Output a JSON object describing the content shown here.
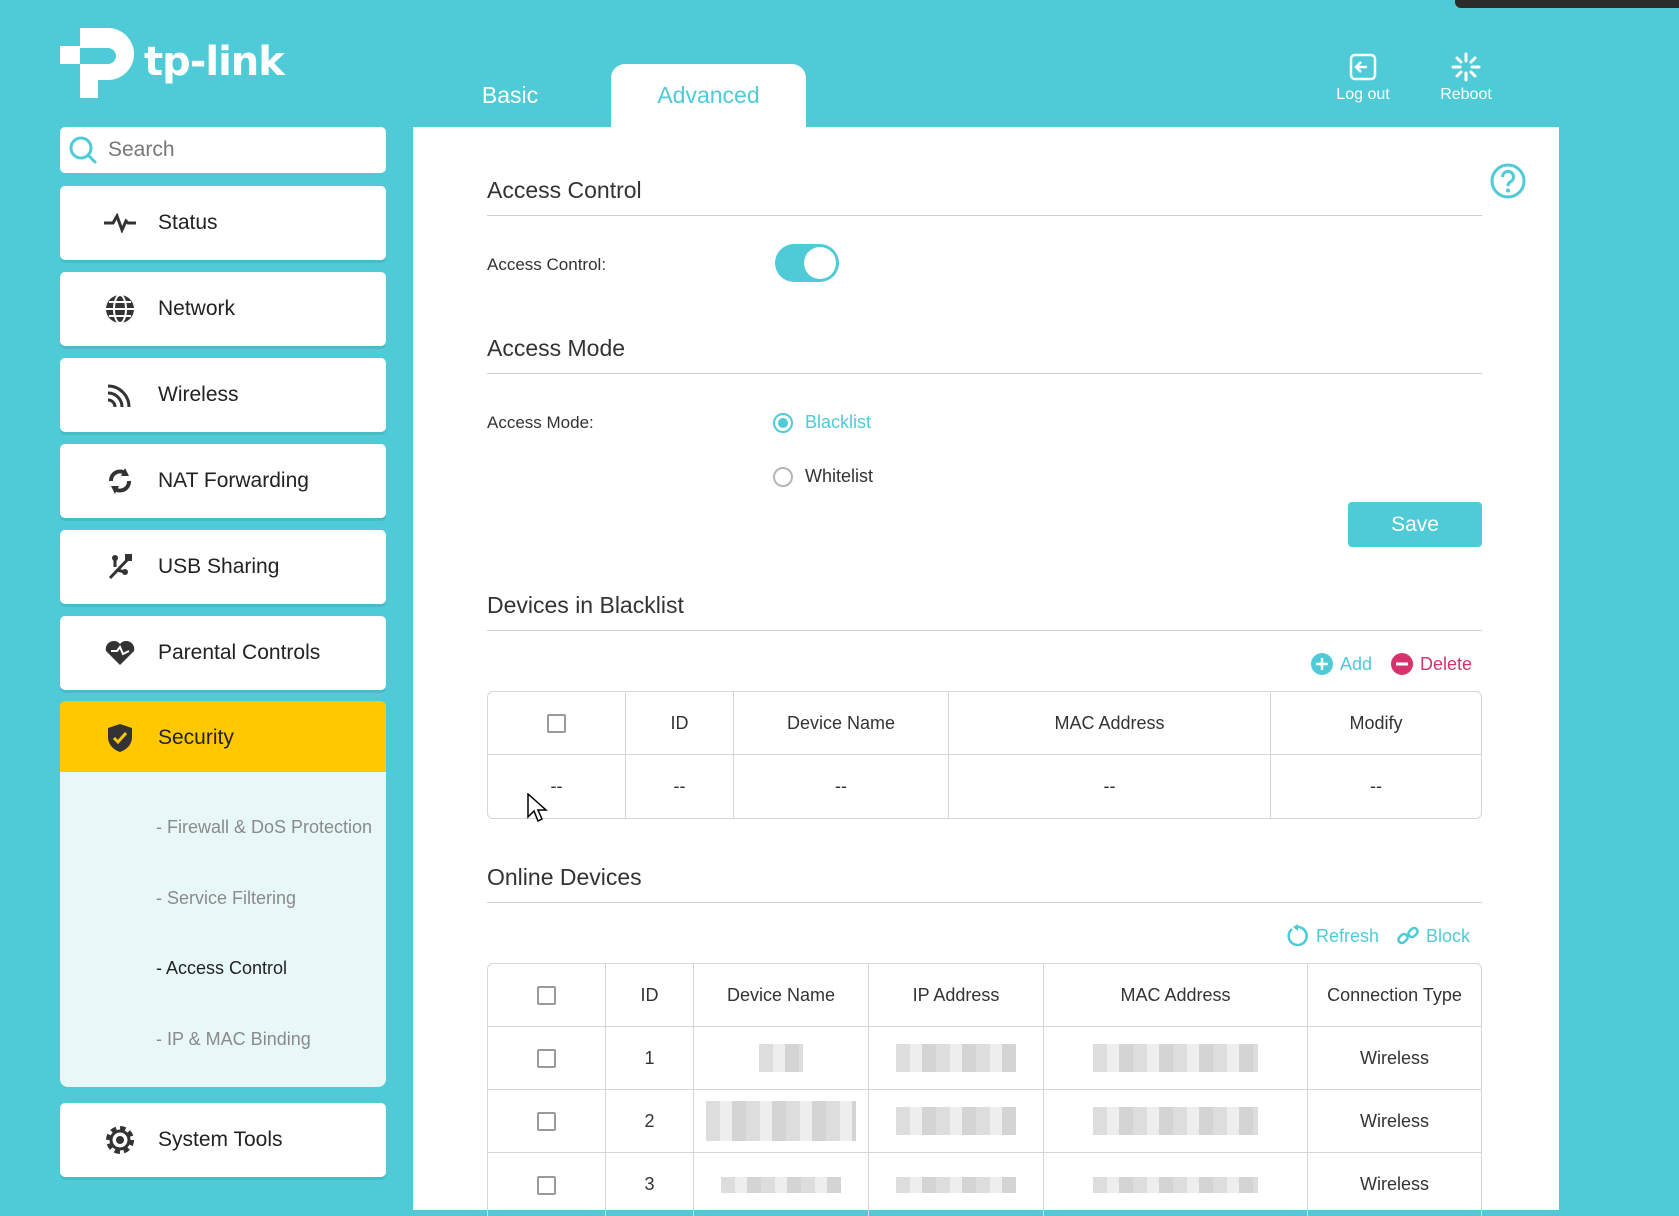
{
  "brand": {
    "name": "tp-link"
  },
  "tabs": [
    {
      "label": "Basic"
    },
    {
      "label": "Advanced"
    }
  ],
  "top_actions": {
    "logout": "Log out",
    "reboot": "Reboot"
  },
  "search": {
    "placeholder": "Search"
  },
  "sidebar": {
    "items": [
      {
        "label": "Status"
      },
      {
        "label": "Network"
      },
      {
        "label": "Wireless"
      },
      {
        "label": "NAT Forwarding"
      },
      {
        "label": "USB Sharing"
      },
      {
        "label": "Parental Controls"
      },
      {
        "label": "Security"
      },
      {
        "label": "System Tools"
      }
    ],
    "security_sub": [
      {
        "label": "- Firewall & DoS Protection"
      },
      {
        "label": "- Service Filtering"
      },
      {
        "label": "- Access Control"
      },
      {
        "label": "- IP & MAC Binding"
      }
    ]
  },
  "access_control": {
    "title": "Access Control",
    "label": "Access Control:",
    "enabled": true
  },
  "access_mode": {
    "title": "Access Mode",
    "label": "Access Mode:",
    "options": [
      "Blacklist",
      "Whitelist"
    ],
    "selected": "Blacklist",
    "save_label": "Save"
  },
  "blacklist": {
    "title": "Devices in Blacklist",
    "add_label": "Add",
    "delete_label": "Delete",
    "columns": [
      "ID",
      "Device Name",
      "MAC Address",
      "Modify"
    ],
    "empty_cell": "--"
  },
  "online": {
    "title": "Online Devices",
    "refresh_label": "Refresh",
    "block_label": "Block",
    "columns": [
      "ID",
      "Device Name",
      "IP Address",
      "MAC Address",
      "Connection Type"
    ],
    "rows": [
      {
        "id": "1",
        "connection": "Wireless"
      },
      {
        "id": "2",
        "connection": "Wireless"
      },
      {
        "id": "3",
        "connection": "Wireless"
      }
    ]
  },
  "colors": {
    "accent": "#4ecbd7",
    "active": "#ffc800",
    "delete": "#d6336c"
  }
}
